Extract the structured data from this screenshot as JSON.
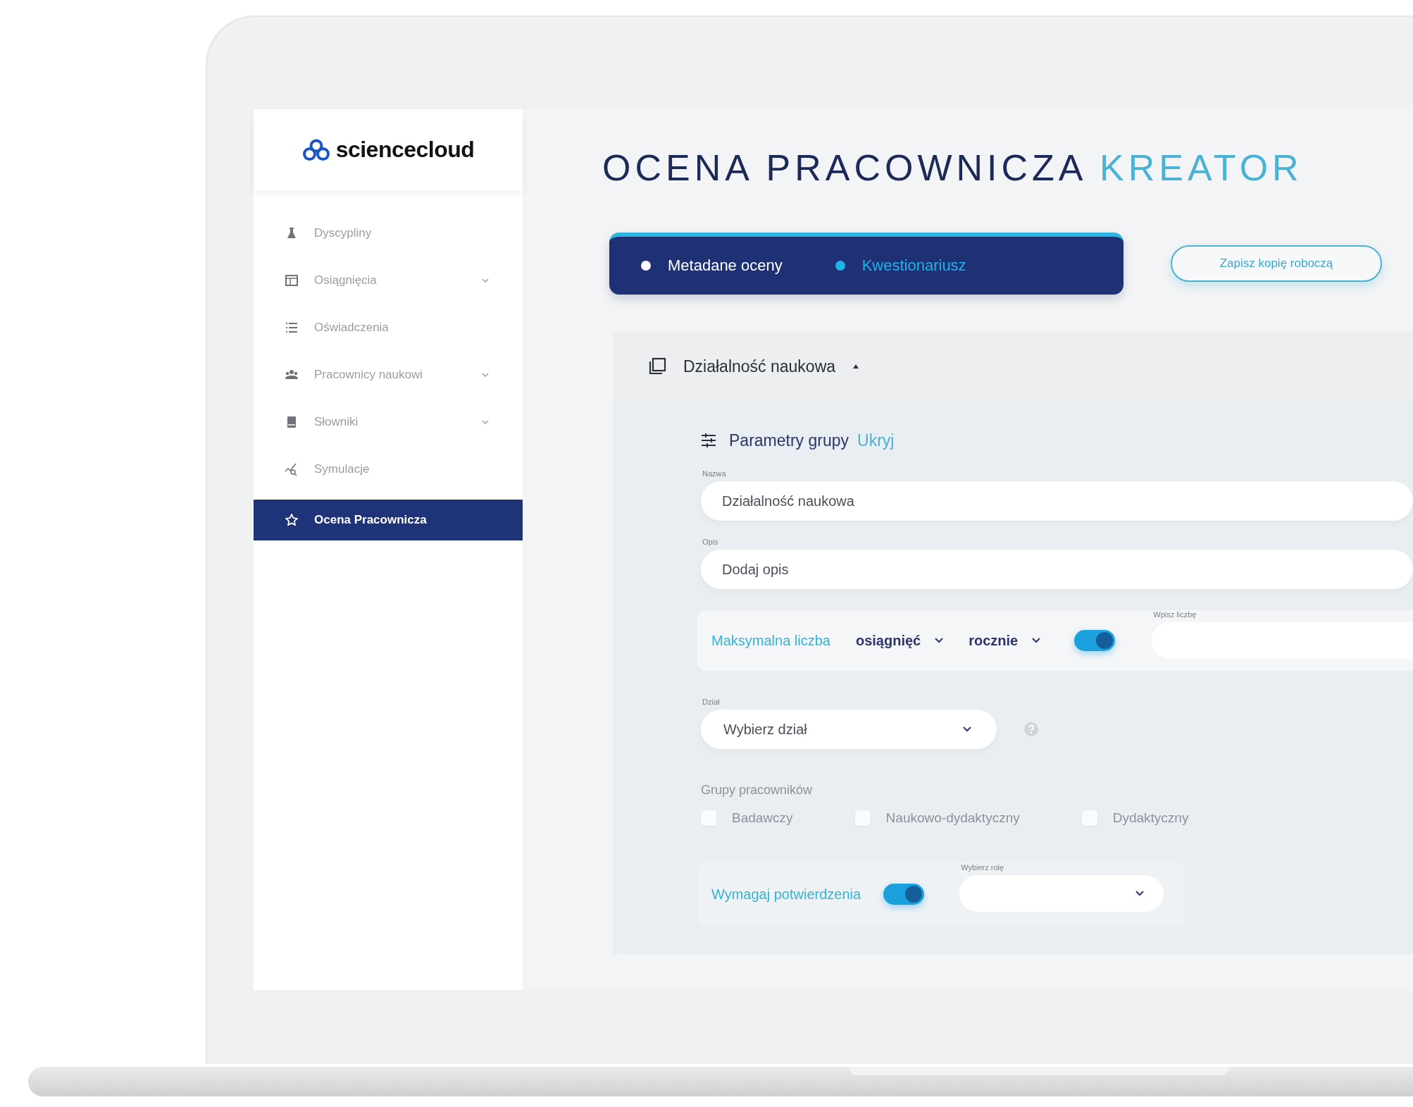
{
  "app": {
    "logo": "sciencecloud"
  },
  "sidebar": {
    "items": [
      {
        "label": "Dyscypliny",
        "has_submenu": false,
        "selected": false
      },
      {
        "label": "Osiągnięcia",
        "has_submenu": true,
        "selected": false
      },
      {
        "label": "Oświadczenia",
        "has_submenu": false,
        "selected": false
      },
      {
        "label": "Pracownicy naukowi",
        "has_submenu": true,
        "selected": false
      },
      {
        "label": "Słowniki",
        "has_submenu": true,
        "selected": false
      },
      {
        "label": "Symulacje",
        "has_submenu": false,
        "selected": false
      },
      {
        "label": "Ocena Pracownicza",
        "has_submenu": false,
        "selected": true
      }
    ]
  },
  "title": {
    "text": "OCENA PRACOWNICZA",
    "accent": "KREATOR"
  },
  "stepper": {
    "steps": [
      {
        "label": "Metadane oceny",
        "selected": false
      },
      {
        "label": "Kwestionariusz",
        "selected": true
      }
    ]
  },
  "save_button": "Zapisz kopię roboczą",
  "section": {
    "title": "Działalność naukowa",
    "expanded": true,
    "params_label": "Parametry grupy",
    "params_toggle": "Ukryj",
    "fields": [
      {
        "label": "Nazwa",
        "value": "Działalność naukowa"
      },
      {
        "label": "Opis",
        "placeholder": "Dodaj opis"
      }
    ],
    "limit": {
      "label": "Maksymalna liczba",
      "unit": "osiągnięć",
      "period": "rocznie",
      "on": true,
      "input_label": "Wpisz liczbę"
    },
    "department": {
      "label": "Dział",
      "placeholder": "Wybierz dział"
    },
    "employee_groups": {
      "label": "Grupy pracowników",
      "options": [
        {
          "label": "Badawczy",
          "checked": false
        },
        {
          "label": "Naukowo-dydaktyczny",
          "checked": false
        },
        {
          "label": "Dydaktyczny",
          "checked": false
        }
      ]
    },
    "confirmation": {
      "label": "Wymagaj potwierdzenia",
      "on": true,
      "role_label": "Wybierz rolę"
    }
  }
}
